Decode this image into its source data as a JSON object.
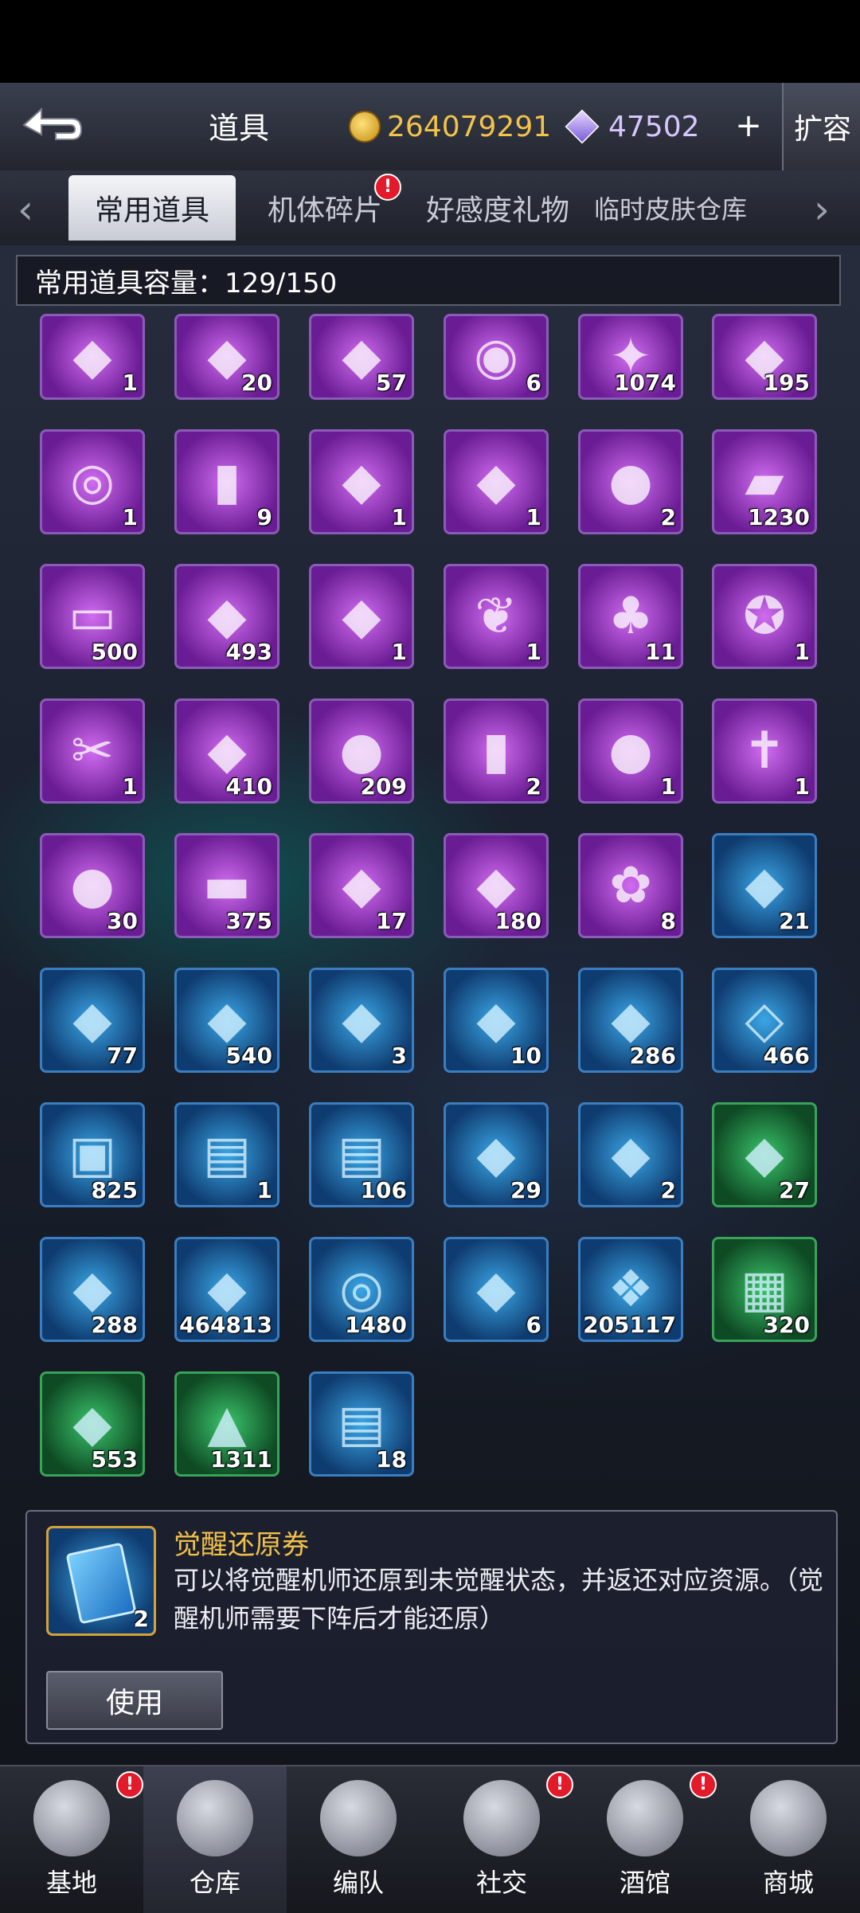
{
  "header": {
    "title": "道具",
    "gold_amount": "264079291",
    "gem_amount": "47502",
    "plus_label": "+",
    "expand_label": "扩容",
    "back_icon": "back-arrow-icon"
  },
  "tabs": [
    {
      "label": "常用道具",
      "active": true
    },
    {
      "label": "机体碎片",
      "badge": "!"
    },
    {
      "label": "好感度礼物"
    },
    {
      "label": "临时皮肤仓库"
    }
  ],
  "capacity_label": "常用道具容量：129/150",
  "items": [
    {
      "count": "1",
      "color": "purple",
      "icon": "mecha-head-icon"
    },
    {
      "count": "20",
      "color": "purple",
      "icon": "red-helmet-icon"
    },
    {
      "count": "57",
      "color": "purple",
      "icon": "blade-icon"
    },
    {
      "count": "6",
      "color": "purple",
      "icon": "gold-coin-icon"
    },
    {
      "count": "1074",
      "color": "purple",
      "icon": "shard-icon"
    },
    {
      "count": "195",
      "color": "purple",
      "icon": "poster-icon"
    },
    {
      "count": "1",
      "color": "purple",
      "icon": "orb-icon"
    },
    {
      "count": "9",
      "color": "purple",
      "icon": "battery-icon"
    },
    {
      "count": "1",
      "color": "purple",
      "icon": "mech-arm-icon"
    },
    {
      "count": "1",
      "color": "purple",
      "icon": "claw-icon"
    },
    {
      "count": "2",
      "color": "purple",
      "icon": "bun-icon"
    },
    {
      "count": "1230",
      "color": "purple",
      "icon": "canister-icon"
    },
    {
      "count": "500",
      "color": "purple",
      "icon": "card-icon"
    },
    {
      "count": "493",
      "color": "purple",
      "icon": "dragon-claw-icon"
    },
    {
      "count": "1",
      "color": "purple",
      "icon": "ticket-icon"
    },
    {
      "count": "1",
      "color": "purple",
      "icon": "feather-icon"
    },
    {
      "count": "11",
      "color": "purple",
      "icon": "broccoli-icon"
    },
    {
      "count": "1",
      "color": "purple",
      "icon": "medal-icon"
    },
    {
      "count": "1",
      "color": "purple",
      "icon": "scissors-icon"
    },
    {
      "count": "410",
      "color": "purple",
      "icon": "crystal-blade-icon"
    },
    {
      "count": "209",
      "color": "purple",
      "icon": "watermelon-icon"
    },
    {
      "count": "2",
      "color": "purple",
      "icon": "capsule-icon"
    },
    {
      "count": "1",
      "color": "purple",
      "icon": "ghost-icon"
    },
    {
      "count": "1",
      "color": "purple",
      "icon": "cross-icon"
    },
    {
      "count": "30",
      "color": "purple",
      "icon": "pumpkin-icon"
    },
    {
      "count": "375",
      "color": "purple",
      "icon": "red-envelope-icon"
    },
    {
      "count": "17",
      "color": "purple",
      "icon": "chocolate-icon"
    },
    {
      "count": "180",
      "color": "purple",
      "icon": "black-crystal-icon"
    },
    {
      "count": "8",
      "color": "purple",
      "icon": "lily-icon"
    },
    {
      "count": "21",
      "color": "blue",
      "icon": "blueprint-icon"
    },
    {
      "count": "77",
      "color": "blue",
      "icon": "frame-card-icon"
    },
    {
      "count": "540",
      "color": "blue",
      "icon": "tube-icon"
    },
    {
      "count": "3",
      "color": "blue",
      "icon": "target-card-icon"
    },
    {
      "count": "10",
      "color": "blue",
      "icon": "target-card-icon"
    },
    {
      "count": "286",
      "color": "blue",
      "icon": "target-card-icon"
    },
    {
      "count": "466",
      "color": "blue",
      "icon": "cube-icon"
    },
    {
      "count": "825",
      "color": "blue",
      "icon": "gift-box-icon"
    },
    {
      "count": "1",
      "color": "blue",
      "icon": "chest-icon"
    },
    {
      "count": "106",
      "color": "blue",
      "icon": "chest-icon"
    },
    {
      "count": "29",
      "color": "blue",
      "icon": "wanted-chest-icon"
    },
    {
      "count": "2",
      "color": "blue",
      "icon": "treasure-icon"
    },
    {
      "count": "27",
      "color": "green",
      "icon": "green-chest-icon"
    },
    {
      "count": "288",
      "color": "blue",
      "icon": "wanted-poster-icon"
    },
    {
      "count": "464813",
      "color": "blue",
      "icon": "gem-icon"
    },
    {
      "count": "1480",
      "color": "blue",
      "icon": "disc-icon"
    },
    {
      "count": "6",
      "color": "blue",
      "icon": "coating-icon"
    },
    {
      "count": "205117",
      "color": "blue",
      "icon": "ice-crystal-icon"
    },
    {
      "count": "320",
      "color": "green",
      "icon": "crate-icon"
    },
    {
      "count": "553",
      "color": "green",
      "icon": "coating-icon"
    },
    {
      "count": "1311",
      "color": "green",
      "icon": "badge-card-icon"
    },
    {
      "count": "18",
      "color": "blue",
      "icon": "black-chest-icon"
    }
  ],
  "detail": {
    "name": "觉醒还原券",
    "count": "2",
    "description": "可以将觉醒机师还原到未觉醒状态，并返还对应资源。（觉醒机师需要下阵后才能还原）",
    "use_label": "使用",
    "icon": "card-icon"
  },
  "nav": [
    {
      "label": "基地",
      "badge": "!",
      "icon": "base-icon"
    },
    {
      "label": "仓库",
      "active": true,
      "icon": "warehouse-icon"
    },
    {
      "label": "编队",
      "icon": "squad-icon"
    },
    {
      "label": "社交",
      "badge": "!",
      "icon": "handshake-icon"
    },
    {
      "label": "酒馆",
      "badge": "!",
      "icon": "tavern-icon"
    },
    {
      "label": "商城",
      "icon": "shop-icon"
    }
  ]
}
